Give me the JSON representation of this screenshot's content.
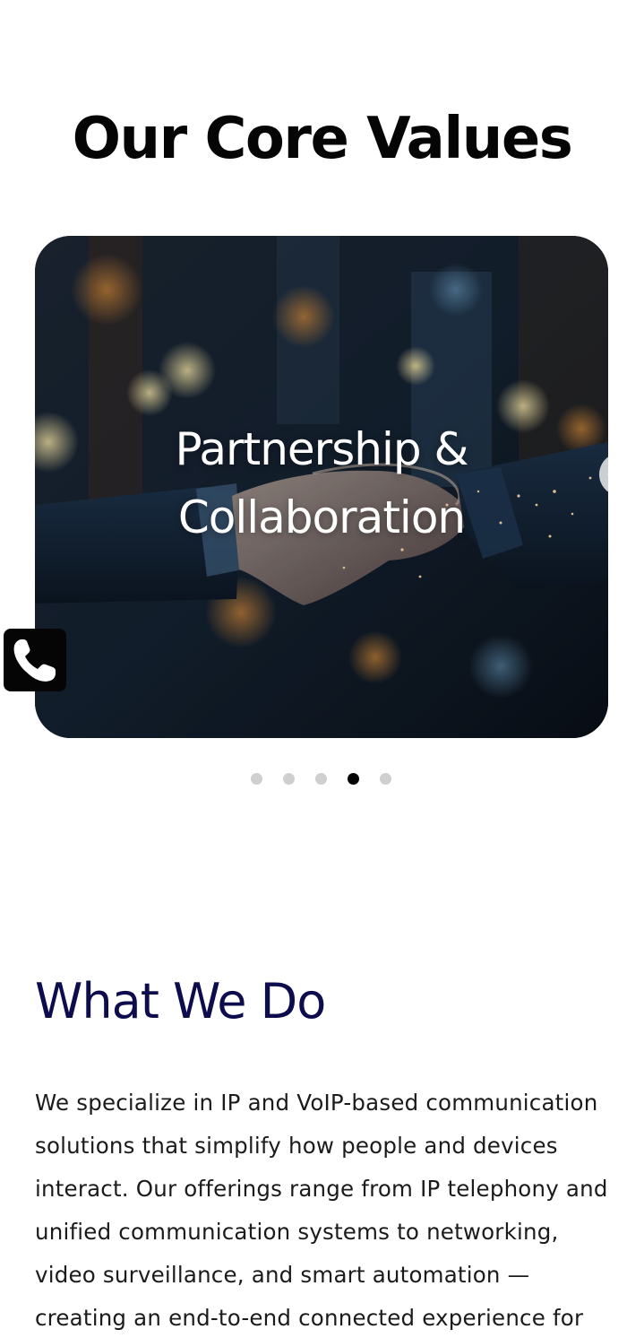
{
  "core_values": {
    "title": "Our Core Values",
    "slide_caption": "Partnership & Collaboration",
    "slide_count": 5,
    "active_slide": 4
  },
  "icons": {
    "prev": "arrow-left-icon",
    "next": "arrow-right-icon",
    "call": "phone-icon"
  },
  "what_we_do": {
    "title": "What We Do",
    "body": "We specialize in IP and VoIP-based communication solutions that simplify how people and devices interact. Our offerings range from IP telephony and unified communication systems to networking, video surveillance, and smart automation — creating an end-to-end connected experience for"
  },
  "colors": {
    "heading_dark": "#050505",
    "heading_navy": "#0d0d4e",
    "dot_inactive": "#cfcfcf",
    "dot_active": "#050505"
  }
}
